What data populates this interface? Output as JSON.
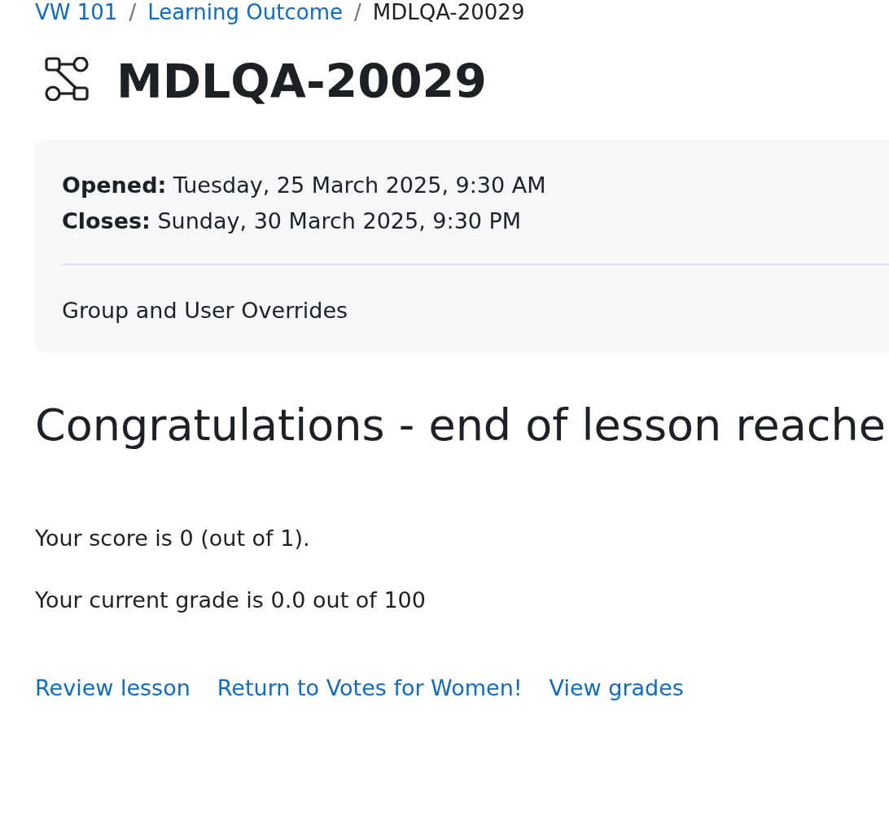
{
  "breadcrumb": {
    "separator": "/",
    "items": [
      {
        "label": "VW 101",
        "kind": "link"
      },
      {
        "label": "Learning Outcome",
        "kind": "link"
      },
      {
        "label": "MDLQA-20029",
        "kind": "current"
      }
    ]
  },
  "page_title": "MDLQA-20029",
  "dates": [
    "**Opened:** Tuesday, 25 March 2025, 9:30 AM",
    "**Closes:** Sunday, 30 March 2025, 9:30 PM"
  ],
  "overrides_text": "Group and User Overrides",
  "heading": "Congratulations - end of lesson reache",
  "messages": [
    "Your score is 0 (out of 1).",
    "Your current grade is 0.0 out of 100"
  ],
  "links": [
    "Review lesson",
    "Return to Votes for Women!",
    "View grades"
  ]
}
